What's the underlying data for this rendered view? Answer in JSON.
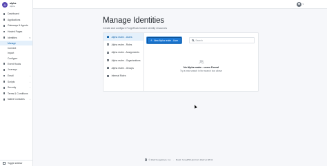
{
  "realm": {
    "avatar_letter": "A",
    "name": "alpha",
    "sub": "Alpha"
  },
  "nav": {
    "items": [
      {
        "label": "Dashboard",
        "icon": "dashboard-icon"
      },
      {
        "label": "Applications",
        "icon": "apps-icon"
      },
      {
        "label": "Gateways & Agents",
        "icon": "gateway-icon"
      },
      {
        "label": "Hosted Pages",
        "icon": "pages-icon"
      }
    ],
    "identities": {
      "label": "Identities",
      "icon": "identities-icon",
      "chevron": "▾"
    },
    "identities_sub": [
      {
        "label": "Manage",
        "active": true
      },
      {
        "label": "Connect"
      },
      {
        "label": "Import"
      },
      {
        "label": "Configure"
      }
    ],
    "items2": [
      {
        "label": "Event Hooks",
        "icon": "hooks-icon"
      },
      {
        "label": "Journeys",
        "icon": "journeys-icon"
      },
      {
        "label": "Email",
        "icon": "email-icon",
        "chevron": "›"
      },
      {
        "label": "Scripts",
        "icon": "scripts-icon",
        "chevron": "›"
      },
      {
        "label": "Security",
        "icon": "security-icon",
        "chevron": "›"
      },
      {
        "label": "Terms & Conditions",
        "icon": "terms-icon"
      },
      {
        "label": "Native Consoles",
        "icon": "consoles-icon",
        "chevron": "›"
      }
    ],
    "toggle_sidebar": "Toggle sidebar"
  },
  "page": {
    "title": "Manage Identities",
    "subtitle": "Create and configure ForgeRock hosted identity resources"
  },
  "tabs": [
    {
      "label": "Alpha realm - Users",
      "active": true,
      "icon": "user-icon"
    },
    {
      "label": "Alpha realm - Roles",
      "icon": "roles-icon"
    },
    {
      "label": "Alpha realm - Assignments",
      "icon": "assignments-icon"
    },
    {
      "label": "Alpha realm - Organizations",
      "icon": "organizations-icon"
    },
    {
      "label": "Alpha realm - Groups",
      "icon": "groups-icon"
    },
    {
      "label": "Internal Roles",
      "icon": "internal-roles-icon"
    }
  ],
  "toolbar": {
    "new_button": "New Alpha realm - User",
    "new_button_icon": "+",
    "search_placeholder": "Search"
  },
  "empty_state": {
    "title": "No Alpha realm - users Found",
    "description": "Try a new search in the search box above"
  },
  "footer": {
    "copyright": "© 2022  ForgeRock, Inc.",
    "build": "Build: 7e1a4f59 April 22, 2022 at 08:34"
  },
  "colors": {
    "accent": "#1c78d4",
    "active_bg": "#e4f0fb",
    "realm_avatar": "#5a4ab3"
  }
}
